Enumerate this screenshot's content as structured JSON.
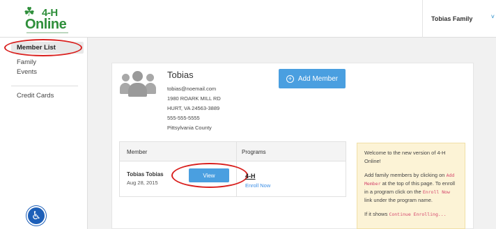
{
  "header": {
    "logo_line1": "4-H",
    "logo_line2": "Online",
    "family_name": "Tobias Family",
    "chevron": "˅"
  },
  "sidebar": {
    "items": [
      {
        "label": "Member List"
      },
      {
        "label": "Family"
      },
      {
        "label": "Events"
      },
      {
        "label": "Credit Cards"
      }
    ]
  },
  "family": {
    "name": "Tobias",
    "email": "tobias@noemail.com",
    "address1": "1980 ROARK MILL RD",
    "address2": "HURT, VA 24563-3889",
    "phone": "555-555-5555",
    "county": "Pittsylvania County"
  },
  "add_member_label": "Add Member",
  "table": {
    "headers": [
      "Member",
      "Programs"
    ],
    "rows": [
      {
        "name": "Tobias Tobias",
        "date": "Aug 28, 2015",
        "view_label": "View",
        "program": "4-H",
        "enroll_label": "Enroll Now"
      }
    ]
  },
  "info": {
    "p1": "Welcome to the new version of 4-H Online!",
    "p2_a": "Add family members by clicking on",
    "p2_code1": "Add Member",
    "p2_b": "at the top of this page. To enroll in a program click on the",
    "p2_code2": "Enroll Now",
    "p2_c": "link under the program name.",
    "p3_a": "If it shows",
    "p3_code": "Continue Enrolling..."
  },
  "colors": {
    "brand_green": "#2f8f3b",
    "button_blue": "#4a9fe0",
    "annotation_red": "#d9201e",
    "info_bg": "#fcf3d6"
  }
}
